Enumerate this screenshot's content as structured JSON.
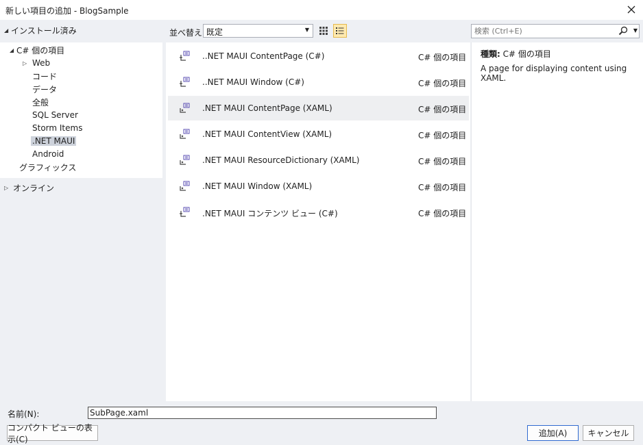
{
  "window": {
    "title": "新しい項目の追加 - BlogSample",
    "close_icon": "close-icon"
  },
  "tree": {
    "installed": {
      "label": "インストール済み",
      "children": [
        {
          "label": "C# 個の項目",
          "children": [
            {
              "label": "Web",
              "expandable": true
            },
            {
              "label": "コード"
            },
            {
              "label": "データ"
            },
            {
              "label": "全般"
            },
            {
              "label": "SQL Server"
            },
            {
              "label": "Storm Items"
            },
            {
              "label": ".NET MAUI",
              "selected": true
            },
            {
              "label": "Android"
            }
          ]
        },
        {
          "label": "グラフィックス"
        }
      ]
    },
    "online": {
      "label": "オンライン"
    }
  },
  "toolbar": {
    "sort_label": "並べ替え:",
    "sort_value": "既定",
    "grid_view_icon": "grid-view-icon",
    "list_view_icon": "list-view-icon"
  },
  "search": {
    "placeholder": "検索 (Ctrl+E)",
    "icon": "search-icon"
  },
  "items": [
    {
      "name": "..NET MAUI ContentPage (C#)",
      "type": "C# 個の項目",
      "icon": "csharp-page-icon"
    },
    {
      "name": "..NET MAUI Window (C#)",
      "type": "C# 個の項目",
      "icon": "csharp-page-icon"
    },
    {
      "name": ".NET MAUI ContentPage (XAML)",
      "type": "C# 個の項目",
      "icon": "xaml-page-icon",
      "selected": true
    },
    {
      "name": ".NET MAUI ContentView (XAML)",
      "type": "C# 個の項目",
      "icon": "xaml-page-icon"
    },
    {
      "name": ".NET MAUI ResourceDictionary (XAML)",
      "type": "C# 個の項目",
      "icon": "xaml-page-icon"
    },
    {
      "name": ".NET MAUI Window (XAML)",
      "type": "C# 個の項目",
      "icon": "xaml-page-icon"
    },
    {
      "name": ".NET MAUI コンテンツ ビュー (C#)",
      "type": "C# 個の項目",
      "icon": "csharp-page-icon"
    }
  ],
  "details": {
    "type_label": "種類:",
    "type_value": "C# 個の項目",
    "description": "A page for displaying content using XAML."
  },
  "bottom": {
    "name_label": "名前(N):",
    "name_value": "SubPage.xaml",
    "compact_view_label": "コンパクト ビューの表示(C)",
    "add_label": "追加(A)",
    "cancel_label": "キャンセル"
  }
}
